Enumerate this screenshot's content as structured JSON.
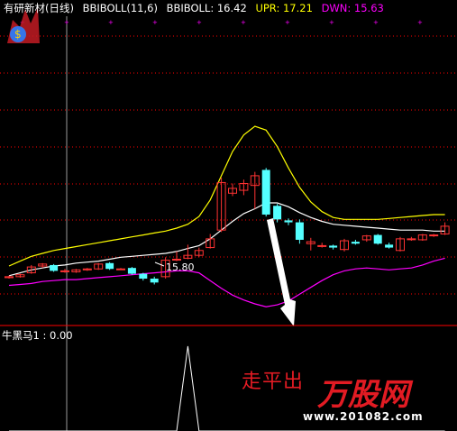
{
  "header": {
    "stock_name": "有研新材(日线)",
    "indicator": "BBIBOLL(11,6)",
    "bbiboll_label": "BBIBOLL: 16.42",
    "upr_label": "UPR: 17.21",
    "dwn_label": "DWN: 15.63"
  },
  "colors": {
    "background": "#000000",
    "bbiboll": "#ffffff",
    "upr": "#ffff00",
    "dwn": "#ff00ff",
    "up_candle": "#ff3333",
    "down_candle": "#54ffff",
    "grid": "#ff0000",
    "cursor": "#9a9a9a"
  },
  "price_annotation": "15.80",
  "sub_panel": {
    "title": "牛黑马1 : 0.00"
  },
  "watermark": {
    "text": "走平出",
    "logo": "万股网",
    "url": "www.201082.com"
  },
  "chart_data": {
    "type": "line",
    "series": [
      {
        "name": "BBIBOLL",
        "values": [
          15.67,
          15.7,
          15.73,
          15.75,
          15.77,
          15.78,
          15.8,
          15.81,
          15.82,
          15.84,
          15.86,
          15.87,
          15.88,
          15.89,
          15.9,
          15.92,
          15.95,
          15.98,
          16.05,
          16.14,
          16.23,
          16.31,
          16.36,
          16.42,
          16.42,
          16.38,
          16.32,
          16.27,
          16.23,
          16.2,
          16.19,
          16.18,
          16.17,
          16.16,
          16.15,
          16.14,
          16.14,
          16.14,
          16.13,
          16.13
        ]
      },
      {
        "name": "UPR",
        "values": [
          15.77,
          15.82,
          15.87,
          15.9,
          15.93,
          15.95,
          15.97,
          15.99,
          16.01,
          16.03,
          16.05,
          16.07,
          16.09,
          16.11,
          16.13,
          16.16,
          16.2,
          16.28,
          16.45,
          16.7,
          16.95,
          17.12,
          17.21,
          17.17,
          17.0,
          16.78,
          16.58,
          16.43,
          16.33,
          16.27,
          16.25,
          16.25,
          16.25,
          16.25,
          16.26,
          16.27,
          16.28,
          16.29,
          16.3,
          16.3
        ]
      },
      {
        "name": "DWN",
        "values": [
          15.57,
          15.58,
          15.59,
          15.61,
          15.62,
          15.63,
          15.63,
          15.64,
          15.65,
          15.66,
          15.67,
          15.68,
          15.69,
          15.7,
          15.71,
          15.72,
          15.72,
          15.7,
          15.62,
          15.54,
          15.47,
          15.42,
          15.38,
          15.35,
          15.37,
          15.41,
          15.48,
          15.55,
          15.62,
          15.68,
          15.72,
          15.74,
          15.75,
          15.74,
          15.73,
          15.74,
          15.75,
          15.78,
          15.82,
          15.85
        ]
      }
    ],
    "candles": [
      {
        "o": 15.65,
        "c": 15.66,
        "h": 15.67,
        "l": 15.64
      },
      {
        "o": 15.66,
        "c": 15.68,
        "h": 15.69,
        "l": 15.65
      },
      {
        "o": 15.7,
        "c": 15.76,
        "h": 15.78,
        "l": 15.69
      },
      {
        "o": 15.77,
        "c": 15.79,
        "h": 15.8,
        "l": 15.75
      },
      {
        "o": 15.78,
        "c": 15.72,
        "h": 15.79,
        "l": 15.71
      },
      {
        "o": 15.72,
        "c": 15.72,
        "h": 15.74,
        "l": 15.7
      },
      {
        "o": 15.71,
        "c": 15.73,
        "h": 15.74,
        "l": 15.7
      },
      {
        "o": 15.73,
        "c": 15.74,
        "h": 15.75,
        "l": 15.72
      },
      {
        "o": 15.74,
        "c": 15.79,
        "h": 15.8,
        "l": 15.73
      },
      {
        "o": 15.8,
        "c": 15.74,
        "h": 15.81,
        "l": 15.73
      },
      {
        "o": 15.74,
        "c": 15.74,
        "h": 15.75,
        "l": 15.73
      },
      {
        "o": 15.75,
        "c": 15.69,
        "h": 15.76,
        "l": 15.68
      },
      {
        "o": 15.69,
        "c": 15.64,
        "h": 15.7,
        "l": 15.62
      },
      {
        "o": 15.64,
        "c": 15.6,
        "h": 15.66,
        "l": 15.58
      },
      {
        "o": 15.66,
        "c": 15.83,
        "h": 15.86,
        "l": 15.64
      },
      {
        "o": 15.84,
        "c": 15.84,
        "h": 15.92,
        "l": 15.82
      },
      {
        "o": 15.85,
        "c": 15.88,
        "h": 15.99,
        "l": 15.84
      },
      {
        "o": 15.88,
        "c": 15.93,
        "h": 15.96,
        "l": 15.86
      },
      {
        "o": 15.96,
        "c": 16.05,
        "h": 16.1,
        "l": 15.95
      },
      {
        "o": 16.14,
        "c": 16.63,
        "h": 16.68,
        "l": 16.12
      },
      {
        "o": 16.52,
        "c": 16.57,
        "h": 16.62,
        "l": 16.49
      },
      {
        "o": 16.55,
        "c": 16.62,
        "h": 16.66,
        "l": 16.5
      },
      {
        "o": 16.6,
        "c": 16.7,
        "h": 16.74,
        "l": 16.36
      },
      {
        "o": 16.76,
        "c": 16.3,
        "h": 16.78,
        "l": 16.28
      },
      {
        "o": 16.39,
        "c": 16.25,
        "h": 16.41,
        "l": 16.22
      },
      {
        "o": 16.24,
        "c": 16.22,
        "h": 16.26,
        "l": 16.19
      },
      {
        "o": 16.22,
        "c": 16.04,
        "h": 16.25,
        "l": 16.0
      },
      {
        "o": 16.0,
        "c": 16.02,
        "h": 16.06,
        "l": 15.93
      },
      {
        "o": 15.98,
        "c": 15.98,
        "h": 16.01,
        "l": 15.96
      },
      {
        "o": 15.98,
        "c": 15.96,
        "h": 15.99,
        "l": 15.94
      },
      {
        "o": 15.94,
        "c": 16.03,
        "h": 16.05,
        "l": 15.92
      },
      {
        "o": 16.02,
        "c": 16.0,
        "h": 16.04,
        "l": 15.99
      },
      {
        "o": 16.04,
        "c": 16.08,
        "h": 16.09,
        "l": 16.02
      },
      {
        "o": 16.09,
        "c": 16.0,
        "h": 16.1,
        "l": 15.99
      },
      {
        "o": 15.99,
        "c": 15.96,
        "h": 16.01,
        "l": 15.95
      },
      {
        "o": 15.93,
        "c": 16.05,
        "h": 16.07,
        "l": 15.92
      },
      {
        "o": 16.05,
        "c": 16.05,
        "h": 16.07,
        "l": 16.03
      },
      {
        "o": 16.04,
        "c": 16.09,
        "h": 16.1,
        "l": 16.03
      },
      {
        "o": 16.09,
        "c": 16.09,
        "h": 16.1,
        "l": 16.07
      },
      {
        "o": 16.1,
        "c": 16.18,
        "h": 16.22,
        "l": 16.09
      }
    ],
    "indicator_values": [
      0,
      0,
      0,
      0,
      0,
      0,
      0,
      0,
      0,
      0,
      0,
      0,
      0,
      0,
      0,
      0,
      1,
      0,
      0,
      0,
      0,
      0,
      0,
      0,
      0,
      0,
      0,
      0,
      0,
      0,
      0,
      0,
      0,
      0,
      0,
      0,
      0,
      0,
      0,
      0
    ]
  }
}
